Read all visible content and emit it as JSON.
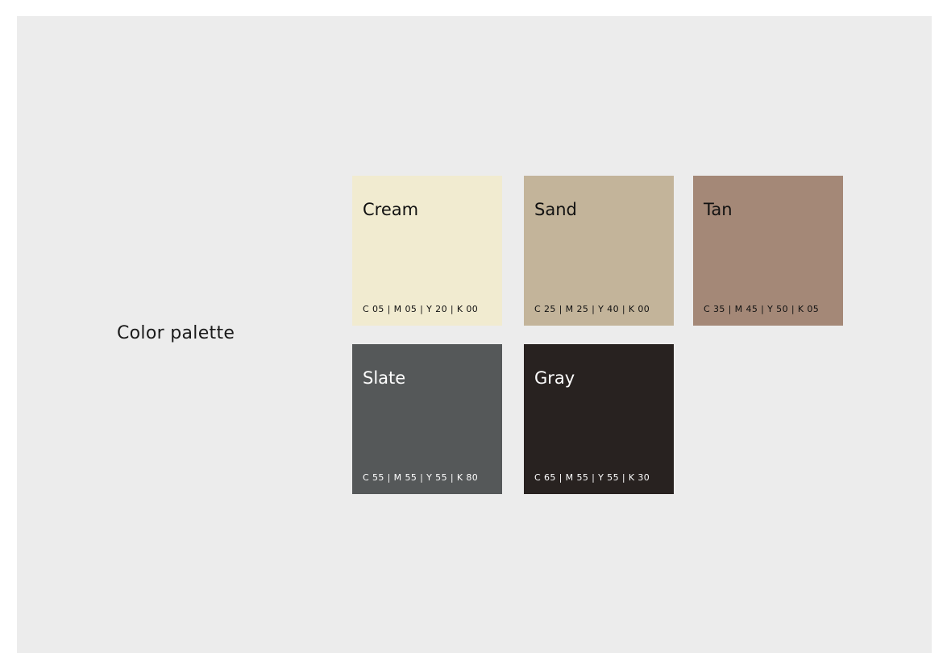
{
  "page": {
    "title": "Color palette",
    "background_color": "#ececec"
  },
  "swatches": [
    {
      "name": "Cream",
      "code": "C 05 | M 05 | Y 20 | K 00",
      "color": "#f1ebd0",
      "text_color": "#111111"
    },
    {
      "name": "Sand",
      "code": "C 25 | M 25 | Y 40 | K 00",
      "color": "#c3b49a",
      "text_color": "#111111"
    },
    {
      "name": "Tan",
      "code": "C 35 | M 45 | Y 50 | K 05",
      "color": "#a48877",
      "text_color": "#111111"
    },
    {
      "name": "Slate",
      "code": "C 55 | M 55 | Y 55 | K 80",
      "color": "#555859",
      "text_color": "#ffffff"
    },
    {
      "name": "Gray",
      "code": "C 65 | M 55 | Y 55 | K 30",
      "color": "#282220",
      "text_color": "#ffffff"
    }
  ]
}
